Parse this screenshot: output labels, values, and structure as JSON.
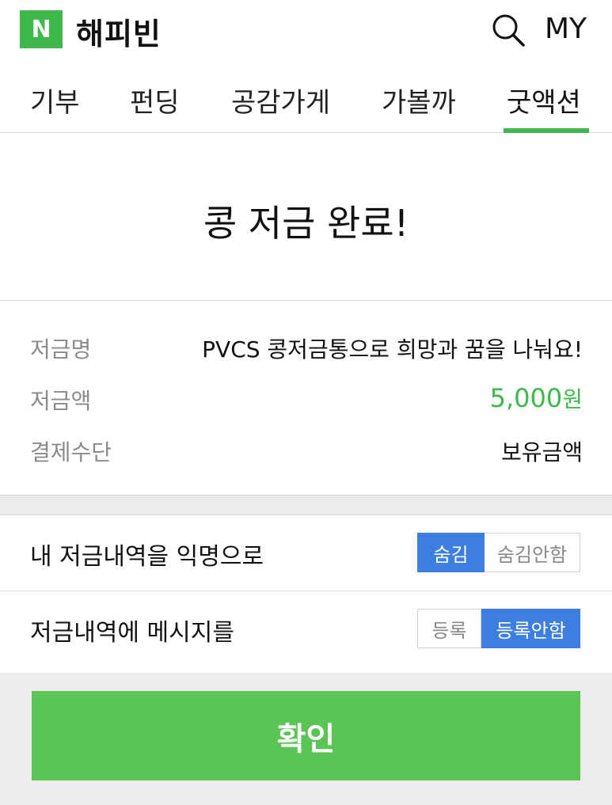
{
  "header": {
    "logo_letter": "N",
    "app_title": "해피빈",
    "my_label": "MY",
    "brand_color": "#3cb94a"
  },
  "nav": {
    "tabs": [
      {
        "label": "기부"
      },
      {
        "label": "펀딩"
      },
      {
        "label": "공감가게"
      },
      {
        "label": "가볼까"
      },
      {
        "label": "굿액션",
        "active": true
      }
    ]
  },
  "hero": {
    "title": "콩 저금 완료!"
  },
  "details": {
    "rows": [
      {
        "label": "저금명",
        "value": "PVCS 콩저금통으로 희망과 꿈을 나눠요!"
      },
      {
        "label": "저금액",
        "amount": "5,000",
        "unit": "원"
      },
      {
        "label": "결제수단",
        "value": "보유금액"
      }
    ]
  },
  "options": {
    "anonymous": {
      "label": "내 저금내역을 익명으로",
      "choices": [
        "숨김",
        "숨김안함"
      ],
      "selected": "숨김"
    },
    "message": {
      "label": "저금내역에 메시지를",
      "choices": [
        "등록",
        "등록안함"
      ],
      "selected": "등록안함"
    },
    "toggle_on_color": "#3d7fe0"
  },
  "confirm": {
    "label": "확인",
    "color": "#5ac455"
  }
}
